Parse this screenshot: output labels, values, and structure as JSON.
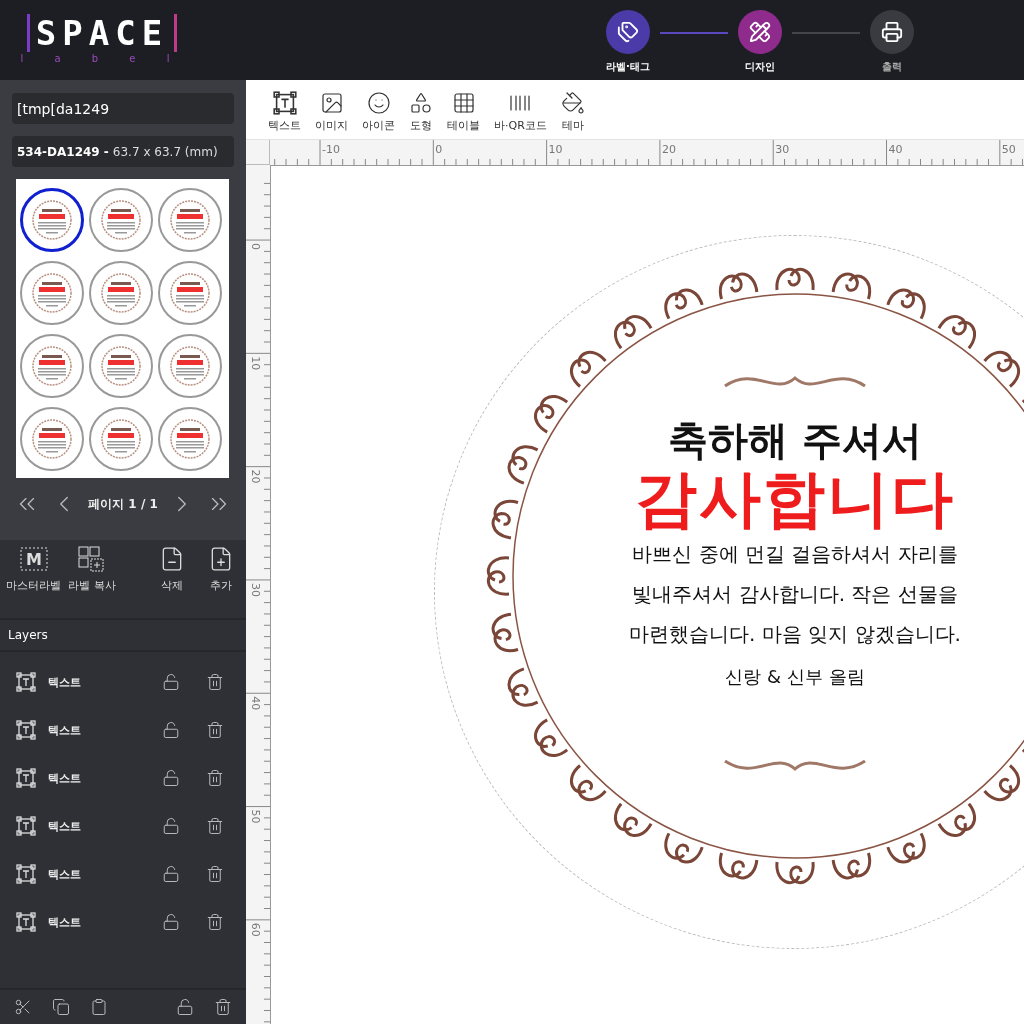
{
  "logo": {
    "word": "SPACE",
    "sub": "l a b e l"
  },
  "steps": [
    {
      "label": "라벨·태그",
      "done": true,
      "selected": false
    },
    {
      "label": "디자인",
      "done": false,
      "selected": true
    },
    {
      "label": "출력",
      "done": false,
      "selected": false
    }
  ],
  "sidebar": {
    "file_name": "[tmp[da1249",
    "size_code": "534-DA1249 -",
    "size_text": "63.7 x 63.7 (mm)",
    "thumbnails": [
      {
        "selected": true
      },
      {
        "selected": false
      },
      {
        "selected": false
      },
      {
        "selected": false
      },
      {
        "selected": false
      },
      {
        "selected": false
      },
      {
        "selected": false
      },
      {
        "selected": false
      },
      {
        "selected": false
      },
      {
        "selected": false
      },
      {
        "selected": false
      },
      {
        "selected": false
      }
    ],
    "page_label": "페이지 1 / 1",
    "actions": [
      {
        "kind": "master",
        "label": "마스터라벨",
        "icon_text": "M"
      },
      {
        "kind": "copy",
        "label": "라벨 복사"
      },
      {
        "kind": "delete",
        "label": "삭제"
      },
      {
        "kind": "add",
        "label": "추가"
      }
    ],
    "layers_title": "Layers",
    "layers": [
      {
        "name": "텍스트",
        "locked": false
      },
      {
        "name": "텍스트",
        "locked": false
      },
      {
        "name": "텍스트",
        "locked": false
      },
      {
        "name": "텍스트",
        "locked": false
      },
      {
        "name": "텍스트",
        "locked": false
      },
      {
        "name": "텍스트",
        "locked": false
      }
    ]
  },
  "toolbar": [
    {
      "kind": "text",
      "label": "텍스트"
    },
    {
      "kind": "image",
      "label": "이미지"
    },
    {
      "kind": "icon",
      "label": "아이콘"
    },
    {
      "kind": "shape",
      "label": "도형"
    },
    {
      "kind": "table",
      "label": "테이블"
    },
    {
      "kind": "barcode",
      "label": "바·QR코드"
    },
    {
      "kind": "theme",
      "label": "테마"
    }
  ],
  "rulers": {
    "horizontal": [
      "-10",
      "0",
      "10",
      "20",
      "30",
      "40",
      "50"
    ],
    "vertical": [
      "0",
      "10",
      "20",
      "30",
      "40",
      "50",
      "60"
    ]
  },
  "label": {
    "heading": "축하해 주셔서",
    "title": "감사합니다",
    "body": [
      "바쁘신 중에 먼길 걸음하셔서 자리를",
      "빛내주셔서 감사합니다. 작은 선물을",
      "마련했습니다. 마음 잊지 않겠습니다."
    ],
    "signature": "신랑 & 신부 올림"
  }
}
